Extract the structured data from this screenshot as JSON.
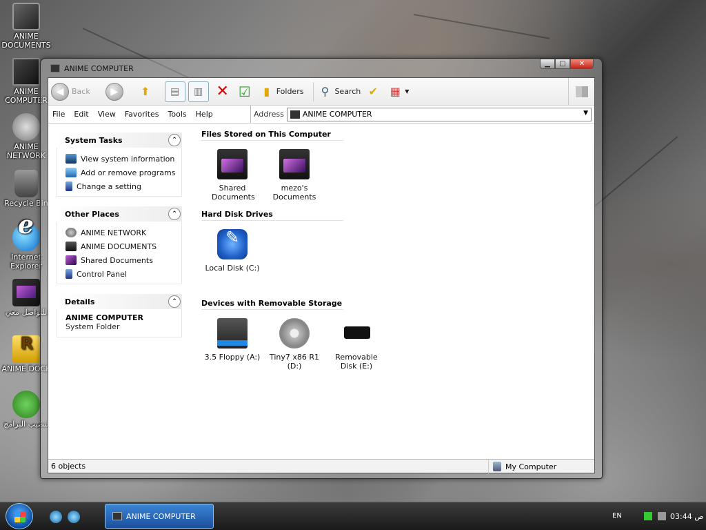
{
  "desktop": {
    "icons": [
      {
        "label": "ANIME DOCUMENTS",
        "icon": "documents-icon"
      },
      {
        "label": "ANIME COMPUTER",
        "icon": "computer-icon"
      },
      {
        "label": "ANIME NETWORK",
        "icon": "network-icon"
      },
      {
        "label": "Recycle Bin",
        "icon": "recycle-bin-icon"
      },
      {
        "label": "Internet Explorer",
        "icon": "internet-explorer-icon"
      },
      {
        "label": "للتواصل معي",
        "icon": "folder-icon"
      },
      {
        "label": "ANIME DOCK",
        "icon": "dock-shortcut-icon"
      },
      {
        "label": "تنصيب البرامج",
        "icon": "installer-shortcut-icon"
      }
    ]
  },
  "window": {
    "title": "ANIME COMPUTER",
    "toolbar": {
      "back": "Back",
      "folders": "Folders",
      "search": "Search"
    },
    "menu": [
      "File",
      "Edit",
      "View",
      "Favorites",
      "Tools",
      "Help"
    ],
    "address": {
      "label": "Address",
      "value": "ANIME COMPUTER"
    },
    "sidebar": {
      "system_tasks": {
        "title": "System Tasks",
        "links": [
          "View system information",
          "Add or remove programs",
          "Change a setting"
        ]
      },
      "other_places": {
        "title": "Other Places",
        "links": [
          "ANIME NETWORK",
          "ANIME DOCUMENTS",
          "Shared Documents",
          "Control Panel"
        ]
      },
      "details": {
        "title": "Details",
        "name": "ANIME COMPUTER",
        "type": "System Folder"
      }
    },
    "groups": {
      "files": {
        "title": "Files Stored on This Computer",
        "items": [
          "Shared Documents",
          "mezo's Documents"
        ]
      },
      "drives": {
        "title": "Hard Disk Drives",
        "items": [
          "Local Disk (C:)"
        ]
      },
      "removable": {
        "title": "Devices with Removable Storage",
        "items": [
          "3.5 Floppy (A:)",
          "Tiny7 x86 R1 (D:)",
          "Removable Disk (E:)"
        ]
      }
    },
    "status": {
      "left": "6 objects",
      "right": "My Computer"
    }
  },
  "taskbar": {
    "active_window": "ANIME COMPUTER",
    "language": "EN",
    "clock": "03:44 ص"
  },
  "colors": {
    "taskbar_active": "#2a6bc0",
    "close_button": "#d8382a"
  }
}
